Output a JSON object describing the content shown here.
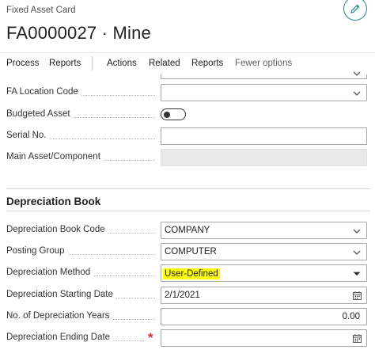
{
  "header": {
    "page_type": "Fixed Asset Card",
    "title": "FA0000027 · Mine",
    "edit_icon": "pencil-icon",
    "accent_color": "#2e8a8a"
  },
  "actions": {
    "process": "Process",
    "reports_1": "Reports",
    "actions": "Actions",
    "related": "Related",
    "reports_2": "Reports",
    "fewer_options": "Fewer options"
  },
  "general_fields": {
    "fa_location_code": {
      "label": "FA Location Code",
      "value": ""
    },
    "budgeted_asset": {
      "label": "Budgeted Asset",
      "value": false
    },
    "serial_no": {
      "label": "Serial No.",
      "value": ""
    },
    "main_asset_component": {
      "label": "Main Asset/Component",
      "value": ""
    }
  },
  "depreciation_book": {
    "section_title": "Depreciation Book",
    "code": {
      "label": "Depreciation Book Code",
      "value": "COMPANY"
    },
    "posting_group": {
      "label": "Posting Group",
      "value": "COMPUTER"
    },
    "method": {
      "label": "Depreciation Method",
      "value": "User-Defined",
      "highlight_color": "#ffff00"
    },
    "starting_date": {
      "label": "Depreciation Starting Date",
      "value": "2/1/2021"
    },
    "years": {
      "label": "No. of Depreciation Years",
      "value": "0.00"
    },
    "ending_date": {
      "label": "Depreciation Ending Date",
      "value": "",
      "required_mark": "*",
      "required_color": "#d13438"
    }
  }
}
